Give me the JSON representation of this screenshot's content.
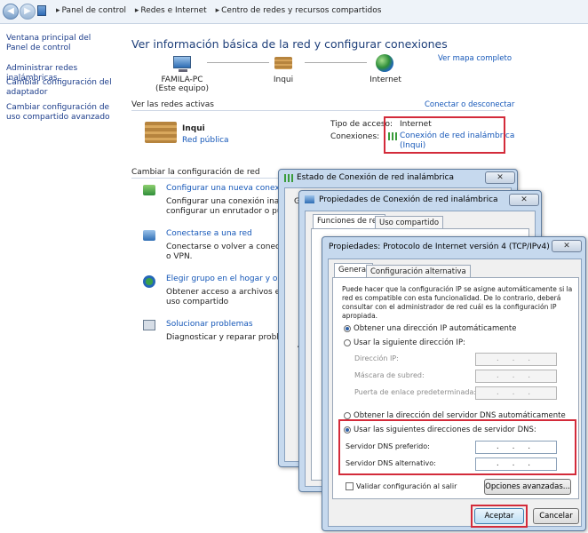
{
  "address": {
    "crumbs": [
      "Panel de control",
      "Redes e Internet",
      "Centro de redes y recursos compartidos"
    ]
  },
  "sidebar": {
    "items": [
      {
        "label": "Ventana principal del Panel de control"
      },
      {
        "label": "Administrar redes inalámbricas"
      },
      {
        "label": "Cambiar configuración del adaptador"
      },
      {
        "label": "Cambiar configuración de uso compartido avanzado"
      }
    ]
  },
  "main": {
    "title": "Ver información básica de la red y configurar conexiones",
    "map_link": "Ver mapa completo",
    "nodes": [
      {
        "name": "FAMILA-PC",
        "sub": "(Este equipo)"
      },
      {
        "name": "Inqui",
        "sub": ""
      },
      {
        "name": "Internet",
        "sub": ""
      }
    ],
    "active_title": "Ver las redes activas",
    "connect_link": "Conectar o desconectar",
    "network_name": "Inqui",
    "network_type": "Red pública",
    "access_label": "Tipo de acceso:",
    "access_value": "Internet",
    "conn_label": "Conexiones:",
    "conn_value": "Conexión de red inalámbrica",
    "conn_value_2": "(Inqui)",
    "change_title": "Cambiar la configuración de red",
    "tasks": [
      {
        "link": "Configurar una nueva conexión d",
        "desc1": "Configurar una conexión inalámb",
        "desc2": "configurar un enrutador o punto"
      },
      {
        "link": "Conectarse a una red",
        "desc1": "Conectarse o volver a conectarse",
        "desc2": "o VPN."
      },
      {
        "link": "Elegir grupo en el hogar y opcion",
        "desc1": "Obtener acceso a archivos e impr",
        "desc2": "uso compartido"
      },
      {
        "link": "Solucionar problemas",
        "desc1": "Diagnosticar y reparar problemas",
        "desc2": ""
      }
    ]
  },
  "status_window": {
    "title": "Estado de Conexión de red inalámbrica",
    "close": "✕",
    "tab_fragment": "Ge",
    "side_fragment": "A"
  },
  "props_window": {
    "title": "Propiedades de Conexión de red inalámbrica",
    "close": "✕",
    "tabs": [
      "Funciones de red",
      "Uso compartido"
    ]
  },
  "tcp_window": {
    "title": "Propiedades: Protocolo de Internet versión 4 (TCP/IPv4)",
    "close": "✕",
    "tabs": [
      "General",
      "Configuración alternativa"
    ],
    "intro": "Puede hacer que la configuración IP se asigne automáticamente si la red es compatible con esta funcionalidad. De lo contrario, deberá consultar con el administrador de red cuál es la configuración IP apropiada.",
    "ip_auto": "Obtener una dirección IP automáticamente",
    "ip_manual": "Usar la siguiente dirección IP:",
    "ip_fields": [
      {
        "label": "Dirección IP:",
        "value": ". . ."
      },
      {
        "label": "Máscara de subred:",
        "value": ". . ."
      },
      {
        "label": "Puerta de enlace predeterminada:",
        "value": ". . ."
      }
    ],
    "dns_auto": "Obtener la dirección del servidor DNS automáticamente",
    "dns_manual": "Usar las siguientes direcciones de servidor DNS:",
    "dns_fields": [
      {
        "label": "Servidor DNS preferido:",
        "value": ". . ."
      },
      {
        "label": "Servidor DNS alternativo:",
        "value": ". . ."
      }
    ],
    "validate": "Validar configuración al salir",
    "advanced": "Opciones avanzadas...",
    "accept": "Aceptar",
    "cancel": "Cancelar"
  },
  "colors": {
    "highlight": "#d32b3a",
    "link": "#1557b8"
  }
}
